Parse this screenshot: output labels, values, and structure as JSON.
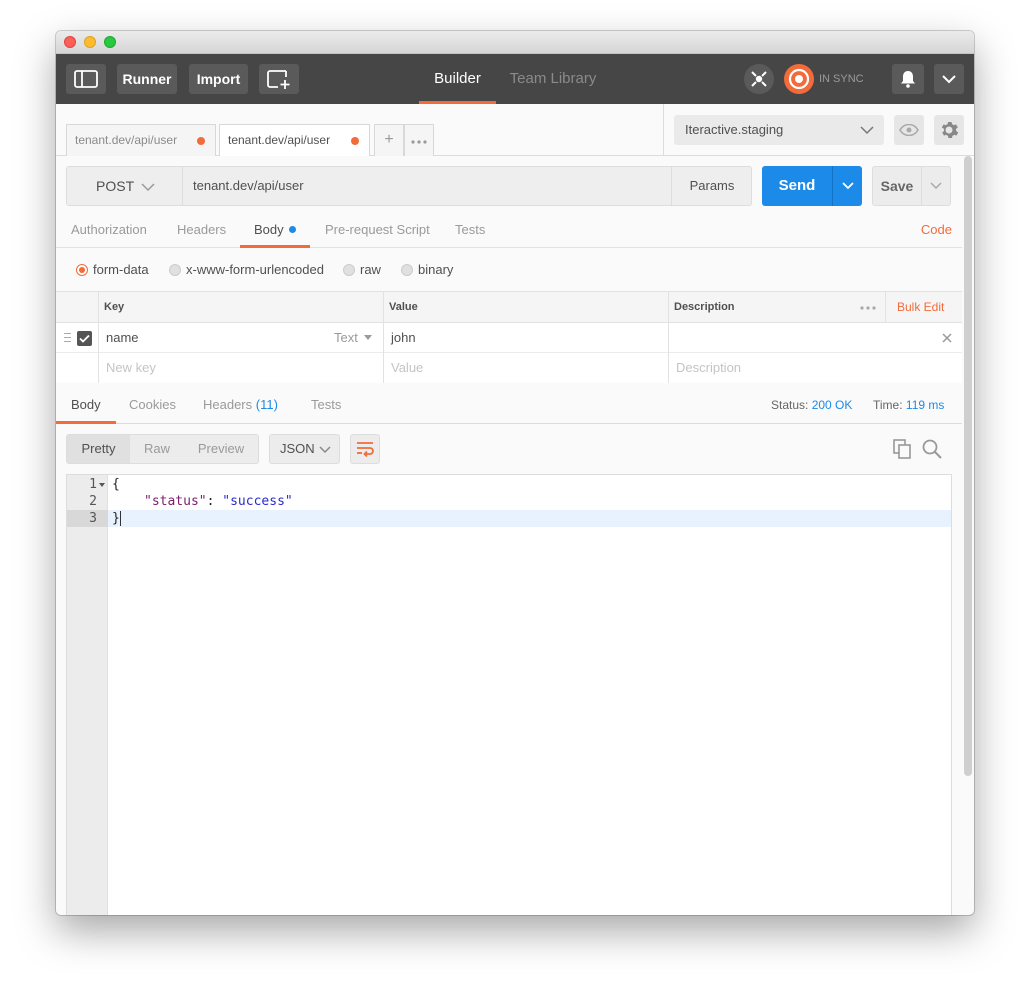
{
  "header": {
    "runner_label": "Runner",
    "import_label": "Import",
    "nav": [
      {
        "label": "Builder",
        "active": true
      },
      {
        "label": "Team Library",
        "active": false
      }
    ],
    "sync_label": "IN SYNC",
    "accent": "#f26b3a",
    "icons": [
      "sidebar-toggle-icon",
      "new-window-icon",
      "interceptor-icon",
      "sync-icon",
      "bell-icon",
      "chevron-down-icon"
    ]
  },
  "tabs": [
    {
      "label": "tenant.dev/api/user",
      "active": false,
      "unsaved": true
    },
    {
      "label": "tenant.dev/api/user",
      "active": true,
      "unsaved": true
    }
  ],
  "environment": {
    "selected": "Iteractive.staging"
  },
  "request": {
    "method": "POST",
    "url": "tenant.dev/api/user",
    "params_label": "Params",
    "send_label": "Send",
    "save_label": "Save",
    "send_color": "#1c8ae8"
  },
  "request_tabs": {
    "items": [
      "Authorization",
      "Headers",
      "Body",
      "Pre-request Script",
      "Tests"
    ],
    "active": "Body",
    "code_link": "Code"
  },
  "body_modes": {
    "options": [
      "form-data",
      "x-www-form-urlencoded",
      "raw",
      "binary"
    ],
    "selected": "form-data"
  },
  "form_table": {
    "headers": {
      "key": "Key",
      "value": "Value",
      "description": "Description",
      "bulk_edit": "Bulk Edit"
    },
    "rows": [
      {
        "key": "name",
        "type": "Text",
        "value": "john",
        "description": "",
        "checked": true
      }
    ],
    "placeholders": {
      "key": "New key",
      "value": "Value",
      "description": "Description"
    }
  },
  "response": {
    "tabs": [
      {
        "label": "Body",
        "active": true
      },
      {
        "label": "Cookies",
        "active": false
      },
      {
        "label": "Headers",
        "count": "(11)",
        "active": false
      },
      {
        "label": "Tests",
        "active": false
      }
    ],
    "status_label": "Status:",
    "status_value": "200 OK",
    "time_label": "Time:",
    "time_value": "119 ms",
    "view_modes": [
      "Pretty",
      "Raw",
      "Preview"
    ],
    "view_selected": "Pretty",
    "format": "JSON"
  },
  "editor": {
    "lines": [
      {
        "num": "1",
        "open": "{"
      },
      {
        "num": "2",
        "key": "\"status\"",
        "sep": ": ",
        "val": "\"success\""
      },
      {
        "num": "3",
        "close": "}"
      }
    ]
  }
}
